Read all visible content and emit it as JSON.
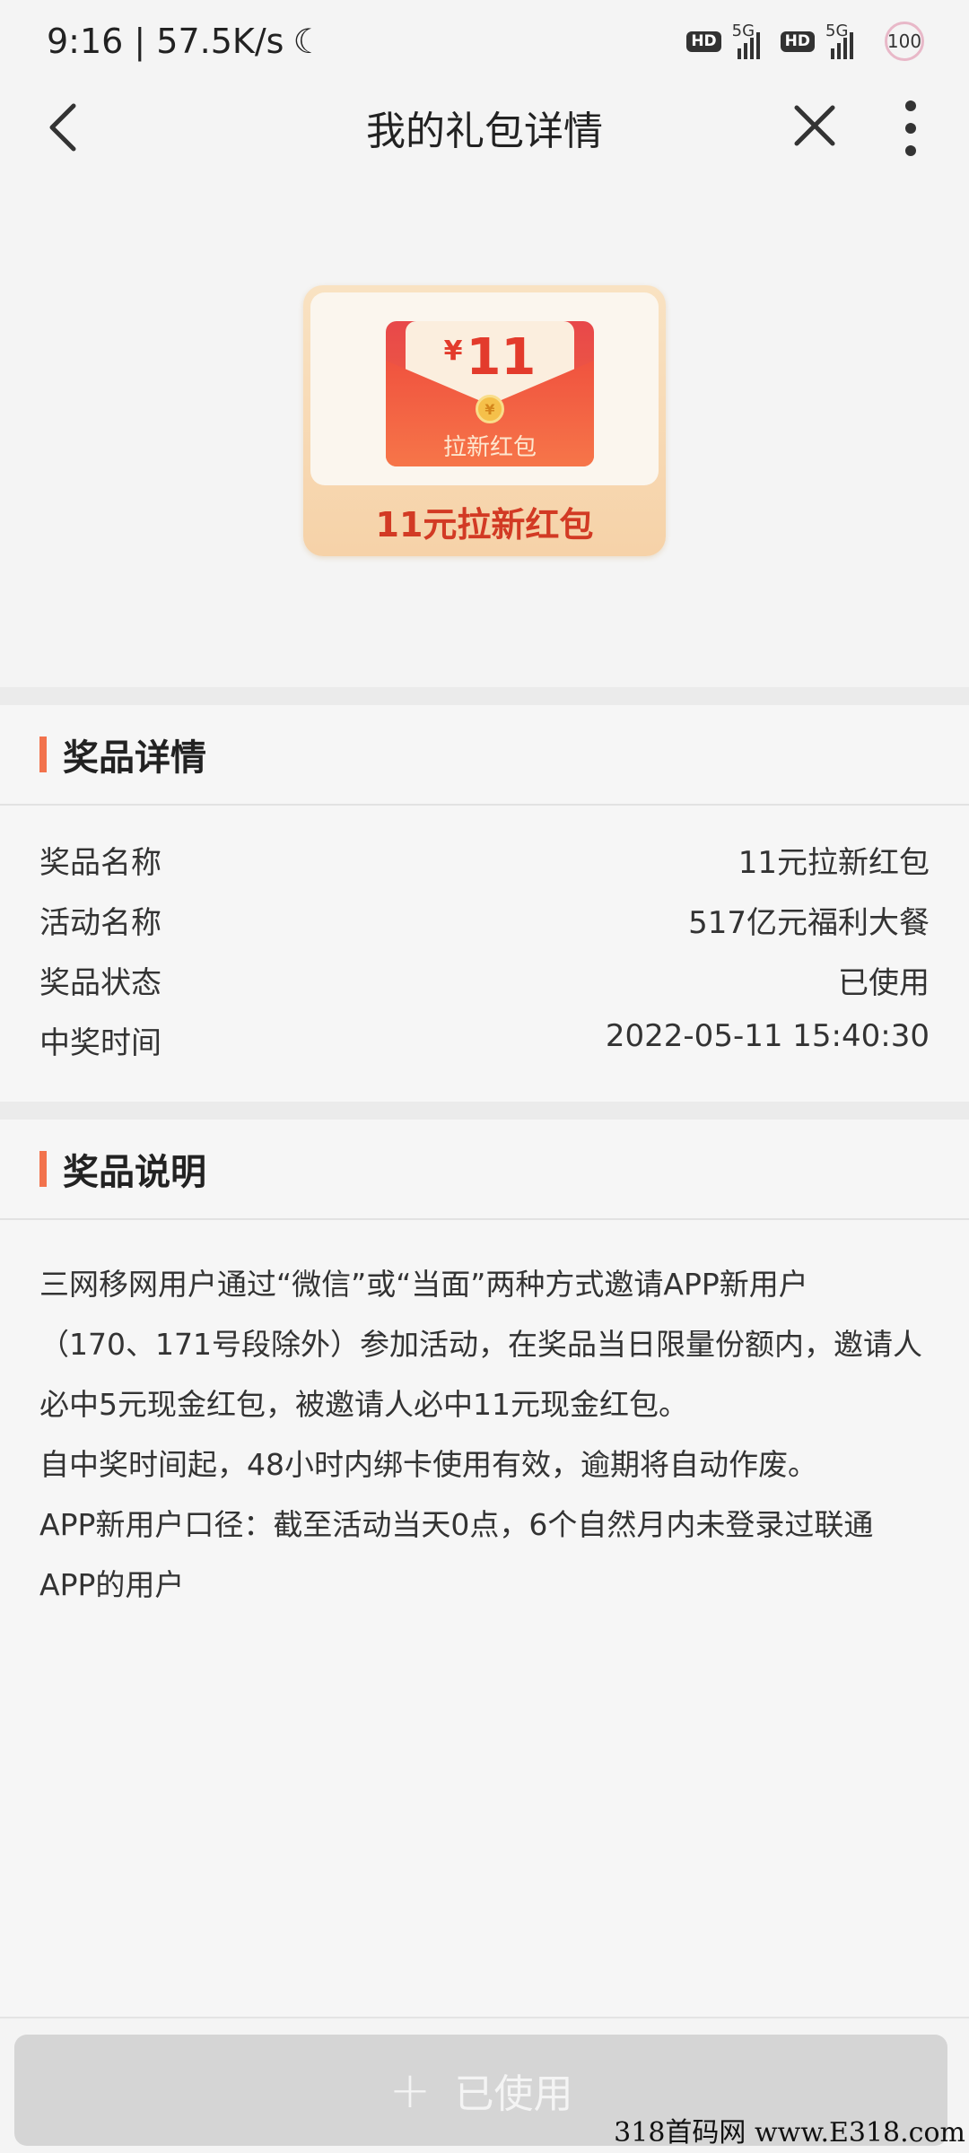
{
  "status_bar": {
    "time_speed": "9:16 | 57.5K/s",
    "moon_icon": "moon-icon",
    "hd": "HD",
    "network": "5G",
    "battery": "100"
  },
  "header": {
    "title": "我的礼包详情",
    "back_icon": "chevron-left-icon",
    "close_icon": "close-icon",
    "more_icon": "more-vertical-icon"
  },
  "reward": {
    "currency": "¥",
    "amount": "11",
    "coin": "¥",
    "envelope_label": "拉新红包",
    "title": "11元拉新红包"
  },
  "prize_details": {
    "heading": "奖品详情",
    "rows": [
      {
        "label": "奖品名称",
        "value": "11元拉新红包"
      },
      {
        "label": "活动名称",
        "value": "517亿元福利大餐"
      },
      {
        "label": "奖品状态",
        "value": "已使用"
      },
      {
        "label": "中奖时间",
        "value": "2022-05-11 15:40:30"
      }
    ]
  },
  "prize_description": {
    "heading": "奖品说明",
    "lines": [
      "三网移网用户通过“微信”或“当面”两种方式邀请APP新用户",
      "（170、171号段除外）参加活动，在奖品当日限量份额内，邀请人",
      "必中5元现金红包，被邀请人必中11元现金红包。",
      "自中奖时间起，48小时内绑卡使用有效，逾期将自动作废。",
      "APP新用户口径：截至活动当天0点，6个自然月内未登录过联通",
      "APP的用户"
    ]
  },
  "bottom_button": {
    "plus": "+",
    "label": "已使用"
  },
  "watermark": "318首码网 www.E318.com",
  "colors": {
    "accent": "#f2734d",
    "reward_red": "#d23a24",
    "button_disabled": "#d5d5d5"
  }
}
